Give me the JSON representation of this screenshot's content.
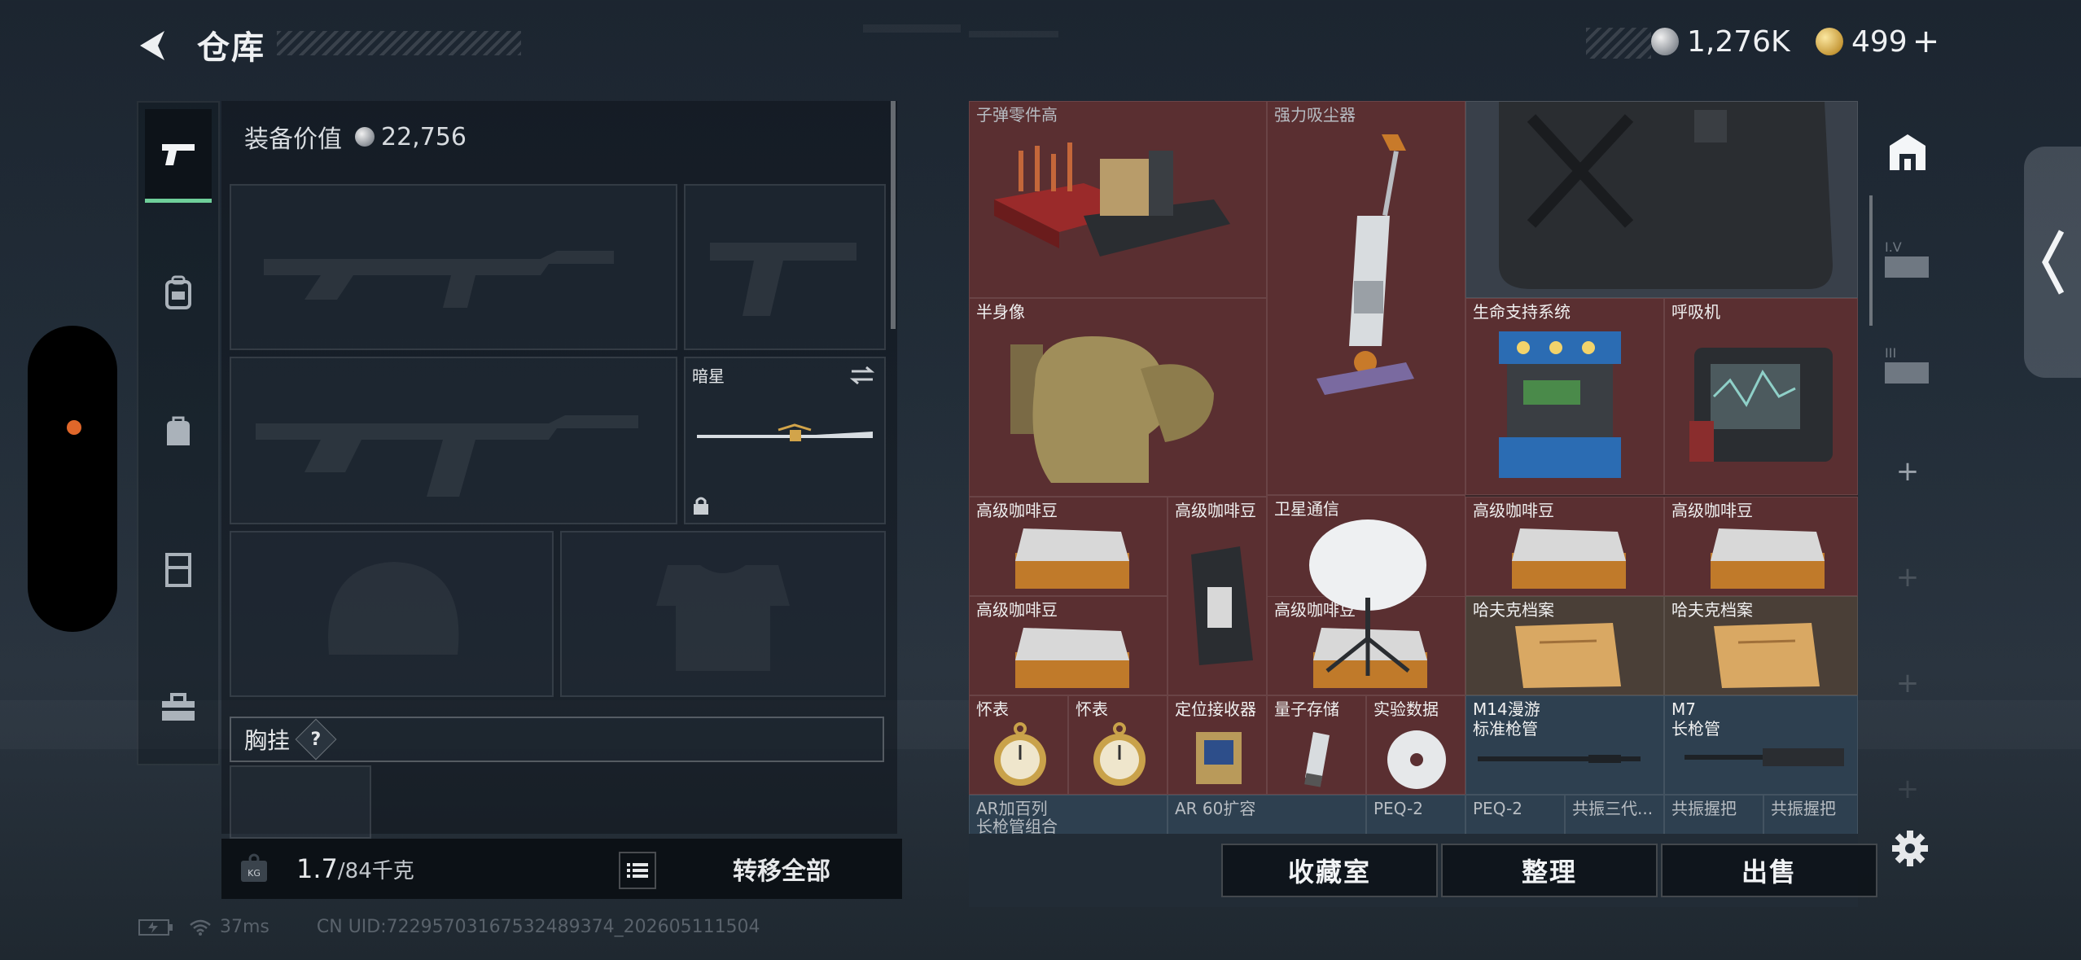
{
  "header": {
    "title": "仓库",
    "currency_silver": "1,276K",
    "currency_gold": "499",
    "gold_plus": "+"
  },
  "left_rail": {
    "items": [
      {
        "icon": "pistol-icon",
        "active": true
      },
      {
        "icon": "backpack-icon",
        "active": false
      },
      {
        "icon": "bag-icon",
        "active": false
      },
      {
        "icon": "rig-icon",
        "active": false
      },
      {
        "icon": "toolbox-icon",
        "active": false
      }
    ]
  },
  "loadout": {
    "equip_value_label": "装备价值",
    "equip_value": "22,756",
    "melee_name": "暗星",
    "chest_label": "胸挂",
    "chest_help": "?"
  },
  "weight": {
    "current": "1.7",
    "max": "/84千克",
    "transfer_all": "转移全部"
  },
  "stash": {
    "items": [
      {
        "label": "子弹零件高"
      },
      {
        "label": "强力吸尘器"
      },
      {
        "label": "半身像"
      },
      {
        "label": "生命支持系统"
      },
      {
        "label": "呼吸机"
      },
      {
        "label": "卫星通信"
      },
      {
        "label": "高级咖啡豆"
      },
      {
        "label": "高级咖啡豆"
      },
      {
        "label": "高级咖啡豆"
      },
      {
        "label": "高级咖啡豆"
      },
      {
        "label": "高级咖啡豆"
      },
      {
        "label": "高级咖啡豆"
      },
      {
        "label": "哈夫克档案"
      },
      {
        "label": "哈夫克档案"
      },
      {
        "label": "怀表"
      },
      {
        "label": "怀表"
      },
      {
        "label": "定位接收器"
      },
      {
        "label": "量子存储"
      },
      {
        "label": "实验数据"
      },
      {
        "label": "M14漫游",
        "sub": "标准枪管"
      },
      {
        "label": "M7",
        "sub": "长枪管"
      },
      {
        "label": "AR加百列",
        "sub": "长枪管组合"
      },
      {
        "label": "AR 60扩容"
      },
      {
        "label": "PEQ-2"
      },
      {
        "label": "PEQ-2"
      },
      {
        "label": "共振三代..."
      },
      {
        "label": "共振握把"
      },
      {
        "label": "共振握把"
      }
    ]
  },
  "right_rail": {
    "items": [
      {
        "icon": "stash-main-icon"
      },
      {
        "icon": "stash-tab-iv-icon",
        "label": "I.V"
      },
      {
        "icon": "stash-tab-iii-icon",
        "label": "III"
      },
      {
        "icon": "add-tab-icon",
        "label": "+"
      },
      {
        "icon": "add-tab-icon",
        "label": "+"
      },
      {
        "icon": "add-tab-icon",
        "label": "+"
      },
      {
        "icon": "add-tab-icon",
        "label": "+"
      }
    ]
  },
  "actions": {
    "collection": "收藏室",
    "sort": "整理",
    "sell": "出售"
  },
  "status_bar": {
    "ping": "37ms",
    "uid": "CN UID:72295703167532489374_202605111504"
  },
  "colors": {
    "accent_green": "#6fcf9a",
    "stash_red": "#5a2f31",
    "stash_blue": "#2e4050",
    "pill_dot": "#e0672a"
  }
}
